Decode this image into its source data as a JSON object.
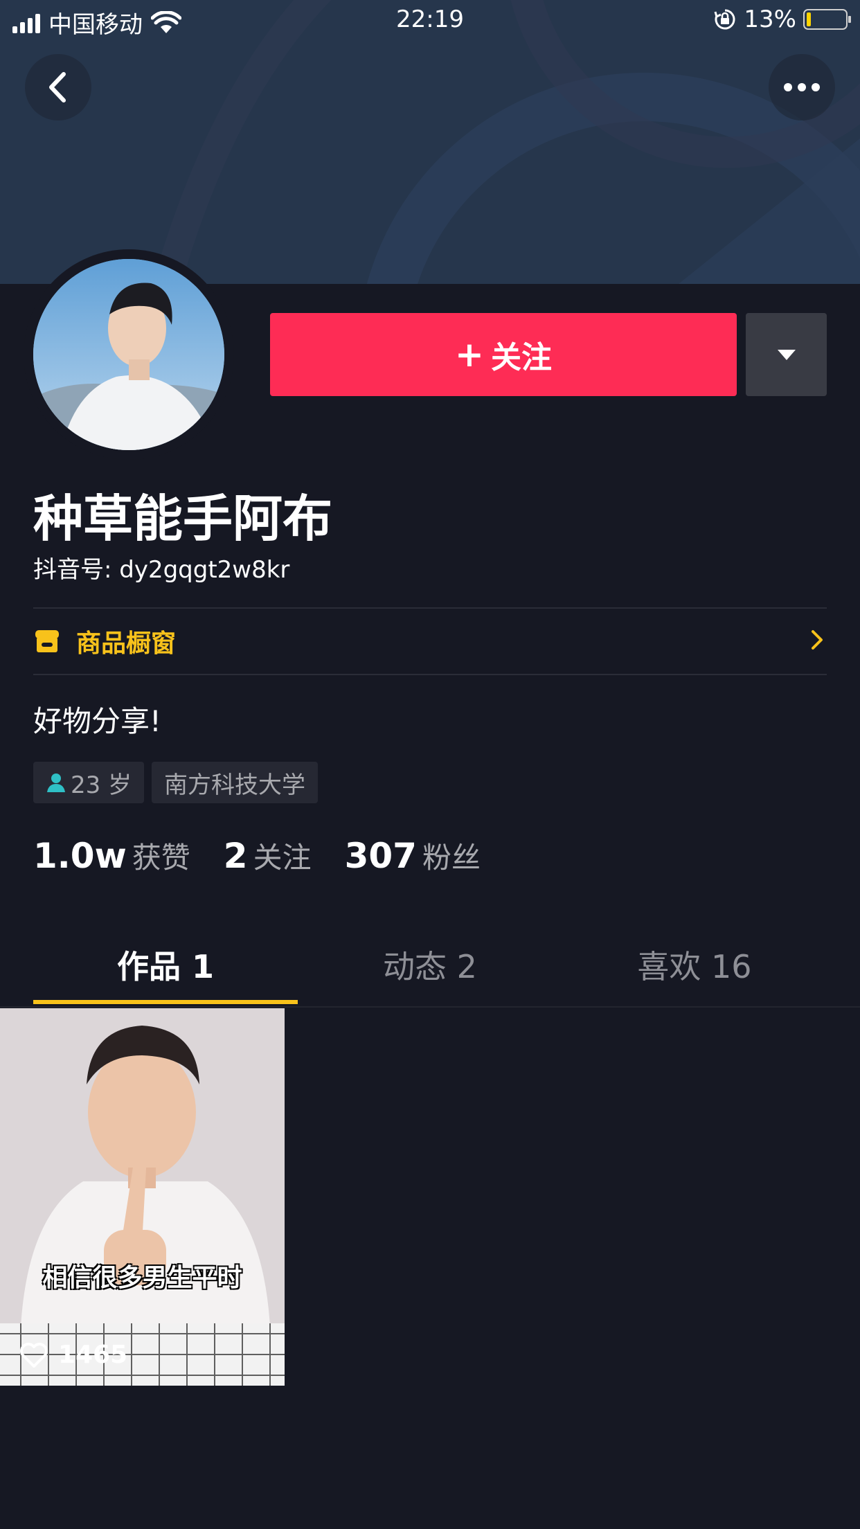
{
  "status_bar": {
    "carrier": "中国移动",
    "time": "22:19",
    "battery_percent": "13%",
    "battery_level": 0.13,
    "battery_color": "#ffd400"
  },
  "header": {
    "back_icon": "chevron-left-icon",
    "more_icon": "more-horizontal-icon"
  },
  "profile": {
    "name": "种草能手阿布",
    "douyin_id": "抖音号: dy2gqgt2w8kr",
    "follow_label": "关注",
    "follow_color": "#fe2c55",
    "shop_label": "商品橱窗",
    "shop_color": "#f8c21b",
    "bio": "好物分享!",
    "tags": [
      {
        "label": "23 岁",
        "icon": "person-icon"
      },
      {
        "label": "南方科技大学"
      }
    ]
  },
  "stats": [
    {
      "value": "1.0w",
      "label": "获赞"
    },
    {
      "value": "2",
      "label": "关注"
    },
    {
      "value": "307",
      "label": "粉丝"
    }
  ],
  "tabs": [
    {
      "label": "作品 1",
      "active": true
    },
    {
      "label": "动态 2",
      "active": false
    },
    {
      "label": "喜欢 16",
      "active": false
    }
  ],
  "videos": [
    {
      "caption": "相信很多男生平时",
      "likes": "1465"
    }
  ]
}
